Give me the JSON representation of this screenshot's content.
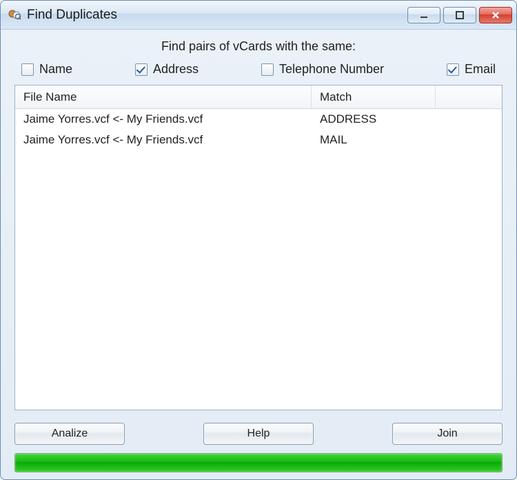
{
  "window": {
    "title": "Find Duplicates"
  },
  "header_label": "Find pairs of vCards with the same:",
  "checks": [
    {
      "label": "Name",
      "checked": false
    },
    {
      "label": "Address",
      "checked": true
    },
    {
      "label": "Telephone Number",
      "checked": false
    },
    {
      "label": "Email",
      "checked": true
    }
  ],
  "columns": {
    "filename": "File Name",
    "match": "Match"
  },
  "rows": [
    {
      "filename": "Jaime Yorres.vcf <- My Friends.vcf",
      "match": "ADDRESS"
    },
    {
      "filename": "Jaime Yorres.vcf <- My Friends.vcf",
      "match": "MAIL"
    }
  ],
  "buttons": {
    "analyze": "Analize",
    "help": "Help",
    "join": "Join"
  }
}
